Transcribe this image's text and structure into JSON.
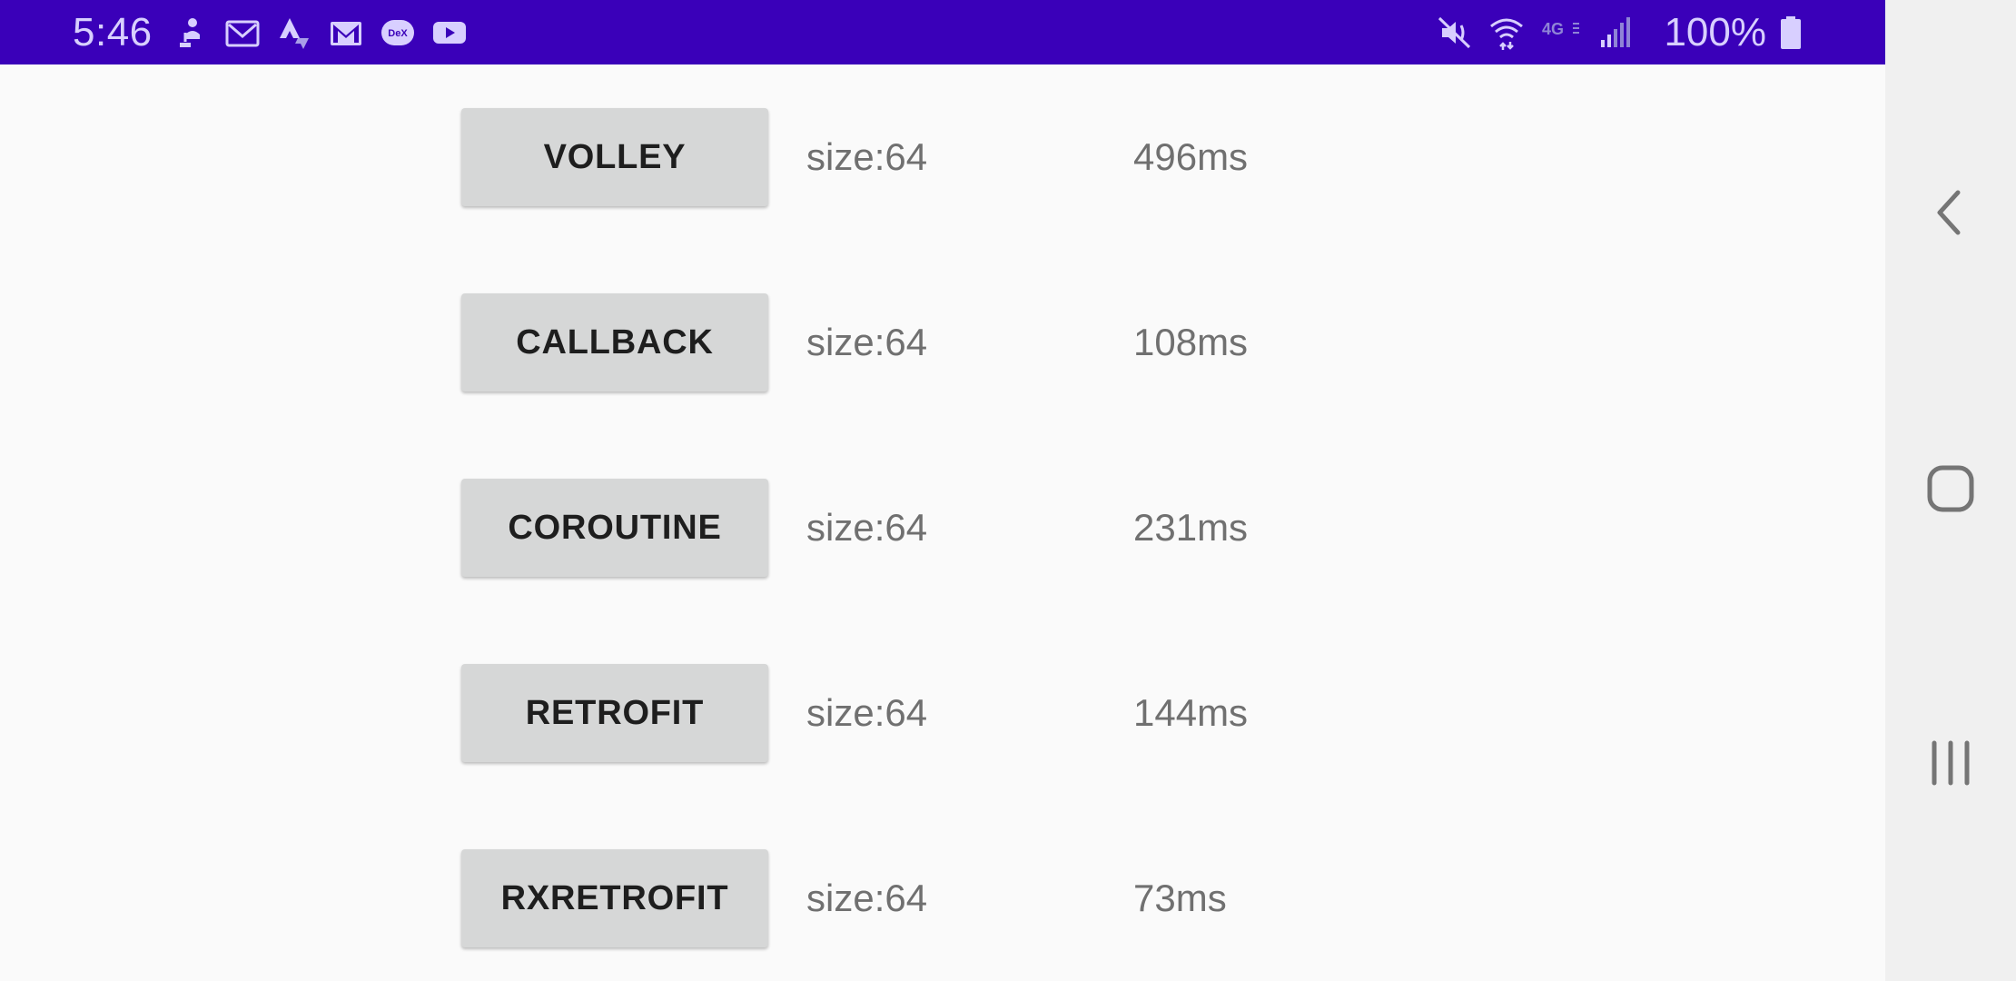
{
  "status_bar": {
    "time": "5:46",
    "battery_percent": "100%",
    "network_label": "4G",
    "background_color": "#3a00b9",
    "left_icons": [
      "upload-person-icon",
      "gmail-outline-icon",
      "strava-icon",
      "gmail-icon",
      "dex-icon",
      "youtube-icon"
    ],
    "right_icons": [
      "mute-icon",
      "wifi-icon",
      "network-type-icon",
      "signal-icon",
      "battery-icon"
    ],
    "dex_label": "DeX"
  },
  "benchmark_rows": [
    {
      "button_label": "VOLLEY",
      "size_text": "size:64",
      "time_text": "496ms"
    },
    {
      "button_label": "CALLBACK",
      "size_text": "size:64",
      "time_text": "108ms"
    },
    {
      "button_label": "COROUTINE",
      "size_text": "size:64",
      "time_text": "231ms"
    },
    {
      "button_label": "RETROFIT",
      "size_text": "size:64",
      "time_text": "144ms"
    },
    {
      "button_label": "RXRETROFIT",
      "size_text": "size:64",
      "time_text": "73ms"
    }
  ],
  "navigation_bar": {
    "buttons": [
      "back-icon",
      "home-icon",
      "recent-apps-icon"
    ]
  }
}
